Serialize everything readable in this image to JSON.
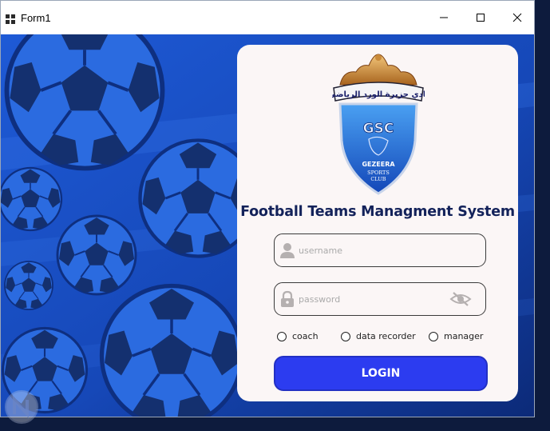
{
  "window": {
    "title": "Form1"
  },
  "login": {
    "club_logo": {
      "arabic_text": "نادي جزيرة الورد الرياضي",
      "monogram": "GSC",
      "line1": "GEZEERA",
      "line2": "SPORTS",
      "line3": "CLUB"
    },
    "app_title": "Football Teams Managment System",
    "username": {
      "placeholder": "username",
      "value": ""
    },
    "password": {
      "placeholder": "password",
      "value": ""
    },
    "roles": [
      {
        "label": "coach",
        "checked": false
      },
      {
        "label": "data recorder",
        "checked": false
      },
      {
        "label": "manager",
        "checked": false
      }
    ],
    "login_label": "LOGIN"
  },
  "colors": {
    "accent": "#2c3cf0",
    "title": "#13225a",
    "background": "#1a4fc2",
    "card": "#fbf6f6"
  },
  "icons": [
    "window-icon",
    "minimize-icon",
    "maximize-icon",
    "close-icon",
    "user-icon",
    "lock-icon",
    "eye-slash-icon"
  ]
}
